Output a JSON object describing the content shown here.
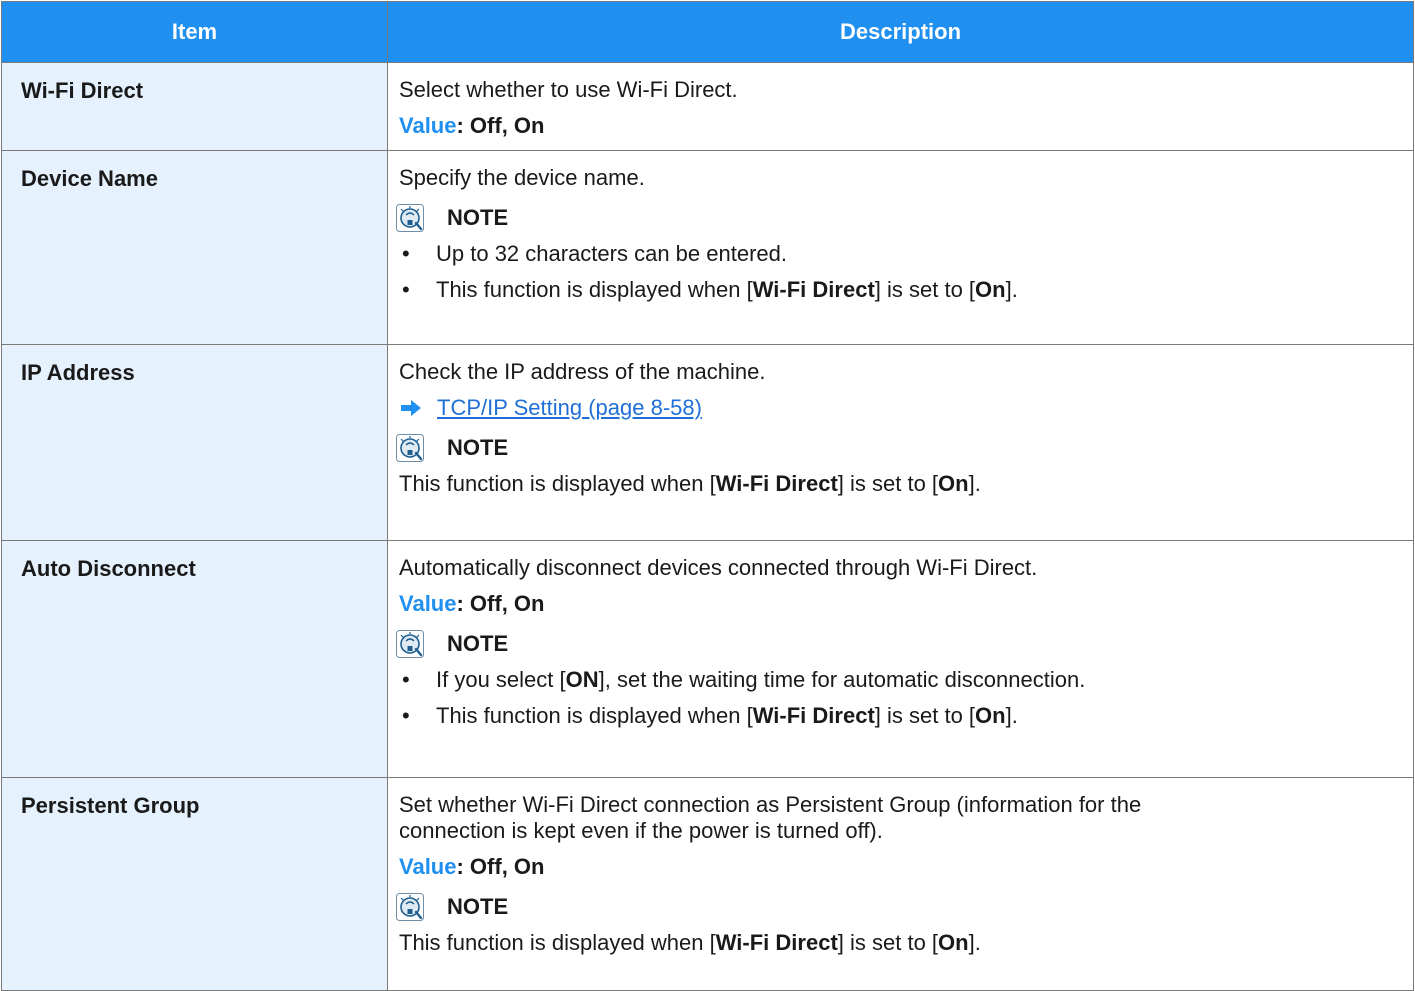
{
  "header": {
    "item": "Item",
    "description": "Description"
  },
  "value_label": "Value",
  "note_label": "NOTE",
  "rows": [
    {
      "item": "Wi-Fi Direct",
      "desc": "Select whether to use Wi-Fi Direct.",
      "value": ": Off, On"
    },
    {
      "item": "Device Name",
      "desc": "Specify the device name.",
      "note_bullets": [
        {
          "text": "Up to 32 characters can be entered."
        },
        {
          "pre": "This function is displayed when [",
          "b1": "Wi-Fi Direct",
          "mid": "] is set to [",
          "b2": "On",
          "post": "]."
        }
      ]
    },
    {
      "item": "IP Address",
      "desc": "Check the IP address of the machine.",
      "link": "TCP/IP Setting (page 8-58)",
      "note_text": {
        "pre": "This function is displayed when [",
        "b1": "Wi-Fi Direct",
        "mid": "] is set to [",
        "b2": "On",
        "post": "]."
      }
    },
    {
      "item": "Auto Disconnect",
      "desc": "Automatically disconnect devices connected through Wi-Fi Direct.",
      "value": ": Off, On",
      "note_bullets": [
        {
          "pre": "If you select [",
          "b1": "ON",
          "post": "], set the waiting time for automatic disconnection."
        },
        {
          "pre": "This function is displayed when [",
          "b1": "Wi-Fi Direct",
          "mid": "] is set to [",
          "b2": "On",
          "post": "]."
        }
      ]
    },
    {
      "item": "Persistent Group",
      "desc_line1": "Set whether Wi-Fi Direct connection as Persistent Group (information for the",
      "desc_line2": "connection is kept even if the power is turned off).",
      "value": ": Off, On",
      "note_text": {
        "pre": "This function is displayed when [",
        "b1": "Wi-Fi Direct",
        "mid": "] is set to [",
        "b2": "On",
        "post": "]."
      }
    }
  ]
}
